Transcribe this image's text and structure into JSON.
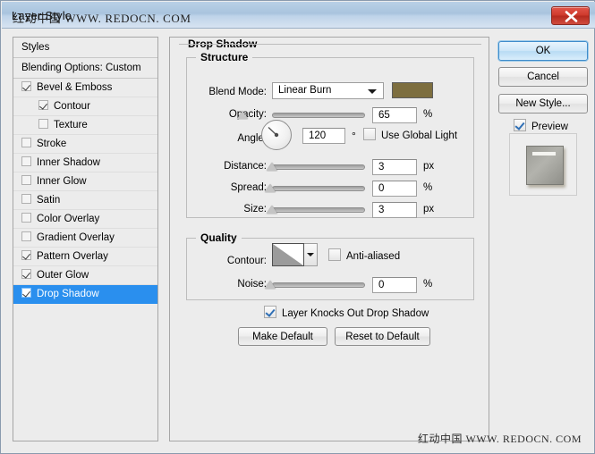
{
  "window": {
    "title": "Layer Style",
    "watermark_top": "红动中国 WWW. REDOCN. COM",
    "watermark_bottom": "红动中国 WWW. REDOCN. COM",
    "close_icon": "close-icon"
  },
  "styles_panel": {
    "header": "Styles",
    "blending_options": "Blending Options: Custom",
    "items": [
      {
        "label": "Bevel & Emboss",
        "checked": true,
        "sub": false,
        "selected": false
      },
      {
        "label": "Contour",
        "checked": true,
        "sub": true,
        "selected": false
      },
      {
        "label": "Texture",
        "checked": false,
        "sub": true,
        "selected": false
      },
      {
        "label": "Stroke",
        "checked": false,
        "sub": false,
        "selected": false
      },
      {
        "label": "Inner Shadow",
        "checked": false,
        "sub": false,
        "selected": false
      },
      {
        "label": "Inner Glow",
        "checked": false,
        "sub": false,
        "selected": false
      },
      {
        "label": "Satin",
        "checked": false,
        "sub": false,
        "selected": false
      },
      {
        "label": "Color Overlay",
        "checked": false,
        "sub": false,
        "selected": false
      },
      {
        "label": "Gradient Overlay",
        "checked": false,
        "sub": false,
        "selected": false
      },
      {
        "label": "Pattern Overlay",
        "checked": true,
        "sub": false,
        "selected": false
      },
      {
        "label": "Outer Glow",
        "checked": true,
        "sub": false,
        "selected": false
      },
      {
        "label": "Drop Shadow",
        "checked": true,
        "sub": false,
        "selected": true
      }
    ]
  },
  "options": {
    "group_title": "Drop Shadow",
    "structure": {
      "title": "Structure",
      "blend_mode_label": "Blend Mode:",
      "blend_mode_value": "Linear Burn",
      "color_swatch": "#7d6e3f",
      "opacity_label": "Opacity:",
      "opacity_value": "65",
      "opacity_unit": "%",
      "angle_label": "Angle:",
      "angle_value": "120",
      "angle_unit": "°",
      "use_global_light_label": "Use Global Light",
      "use_global_light_checked": false,
      "distance_label": "Distance:",
      "distance_value": "3",
      "distance_unit": "px",
      "spread_label": "Spread:",
      "spread_value": "0",
      "spread_unit": "%",
      "size_label": "Size:",
      "size_value": "3",
      "size_unit": "px"
    },
    "quality": {
      "title": "Quality",
      "contour_label": "Contour:",
      "anti_aliased_label": "Anti-aliased",
      "anti_aliased_checked": false,
      "noise_label": "Noise:",
      "noise_value": "0",
      "noise_unit": "%"
    },
    "knockout_label": "Layer Knocks Out Drop Shadow",
    "knockout_checked": true,
    "make_default_label": "Make Default",
    "reset_default_label": "Reset to Default"
  },
  "actions": {
    "ok_label": "OK",
    "cancel_label": "Cancel",
    "new_style_label": "New Style...",
    "preview_label": "Preview",
    "preview_checked": true
  }
}
